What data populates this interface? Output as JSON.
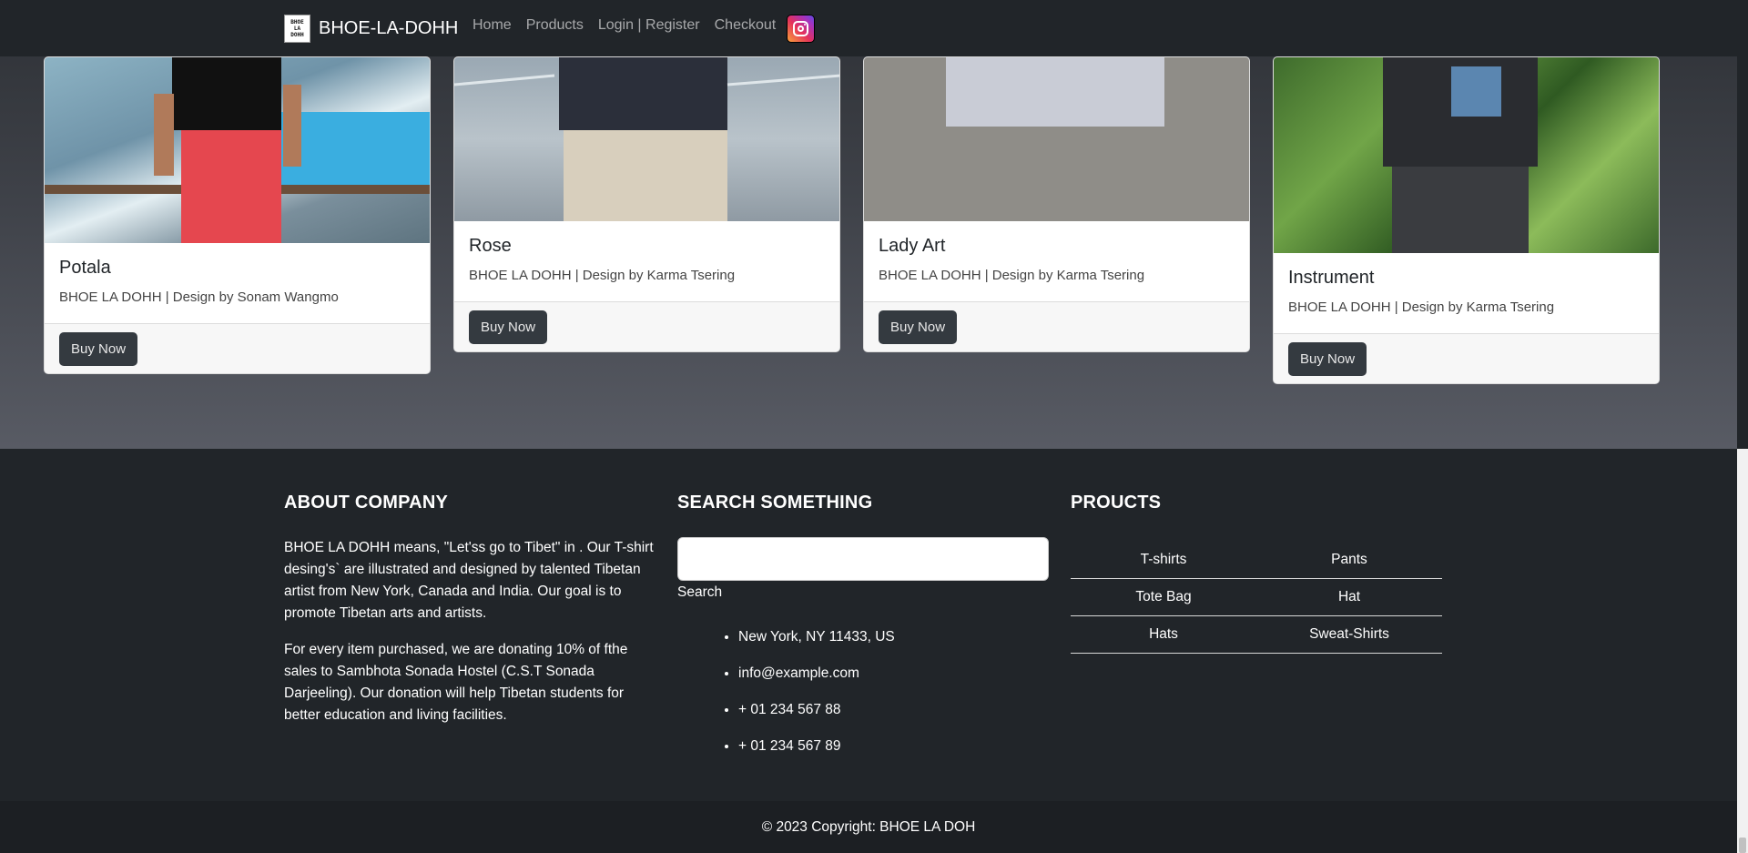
{
  "nav": {
    "brand_logo_text": [
      "BHOE",
      "LA",
      "DOHH"
    ],
    "brand": "BHOE-LA-DOHH",
    "links": [
      "Home",
      "Products",
      "Login | Register",
      "Checkout"
    ],
    "instagram_icon": "instagram-icon"
  },
  "products": [
    {
      "title": "Potala",
      "subtitle": "BHOE LA DOHH | Design by Sonam Wangmo",
      "button": "Buy Now"
    },
    {
      "title": "Rose",
      "subtitle": "BHOE LA DOHH | Design by Karma Tsering",
      "button": "Buy Now"
    },
    {
      "title": "Lady Art",
      "subtitle": "BHOE LA DOHH | Design by Karma Tsering",
      "button": "Buy Now"
    },
    {
      "title": "Instrument",
      "subtitle": "BHOE LA DOHH | Design by Karma Tsering",
      "button": "Buy Now"
    }
  ],
  "footer": {
    "about": {
      "heading": "ABOUT COMPANY",
      "p1": "BHOE LA DOHH means, \"Let'ss go to Tibet\" in . Our T-shirt desing's` are illustrated and designed by talented Tibetan artist from New York, Canada and India. Our goal is to promote Tibetan arts and artists.",
      "p2": "For every item purchased, we are donating 10% of fthe sales to Sambhota Sonada Hostel (C.S.T Sonada Darjeeling). Our donation will help Tibetan students for better education and living facilities."
    },
    "search": {
      "heading": "SEARCH SOMETHING",
      "placeholder": "",
      "button": "Search",
      "contacts": [
        "New York, NY 11433, US",
        "info@example.com",
        "+ 01 234 567 88",
        "+ 01 234 567 89"
      ]
    },
    "products": {
      "heading": "PROUCTS",
      "items": [
        "T-shirts",
        "Pants",
        "Tote Bag",
        "Hat",
        "Hats",
        "Sweat-Shirts"
      ]
    },
    "copyright": "© 2023 Copyright: BHOE LA DOH"
  },
  "colors": {
    "navbar": "#212529",
    "footer": "#212529",
    "button": "#343a40"
  }
}
